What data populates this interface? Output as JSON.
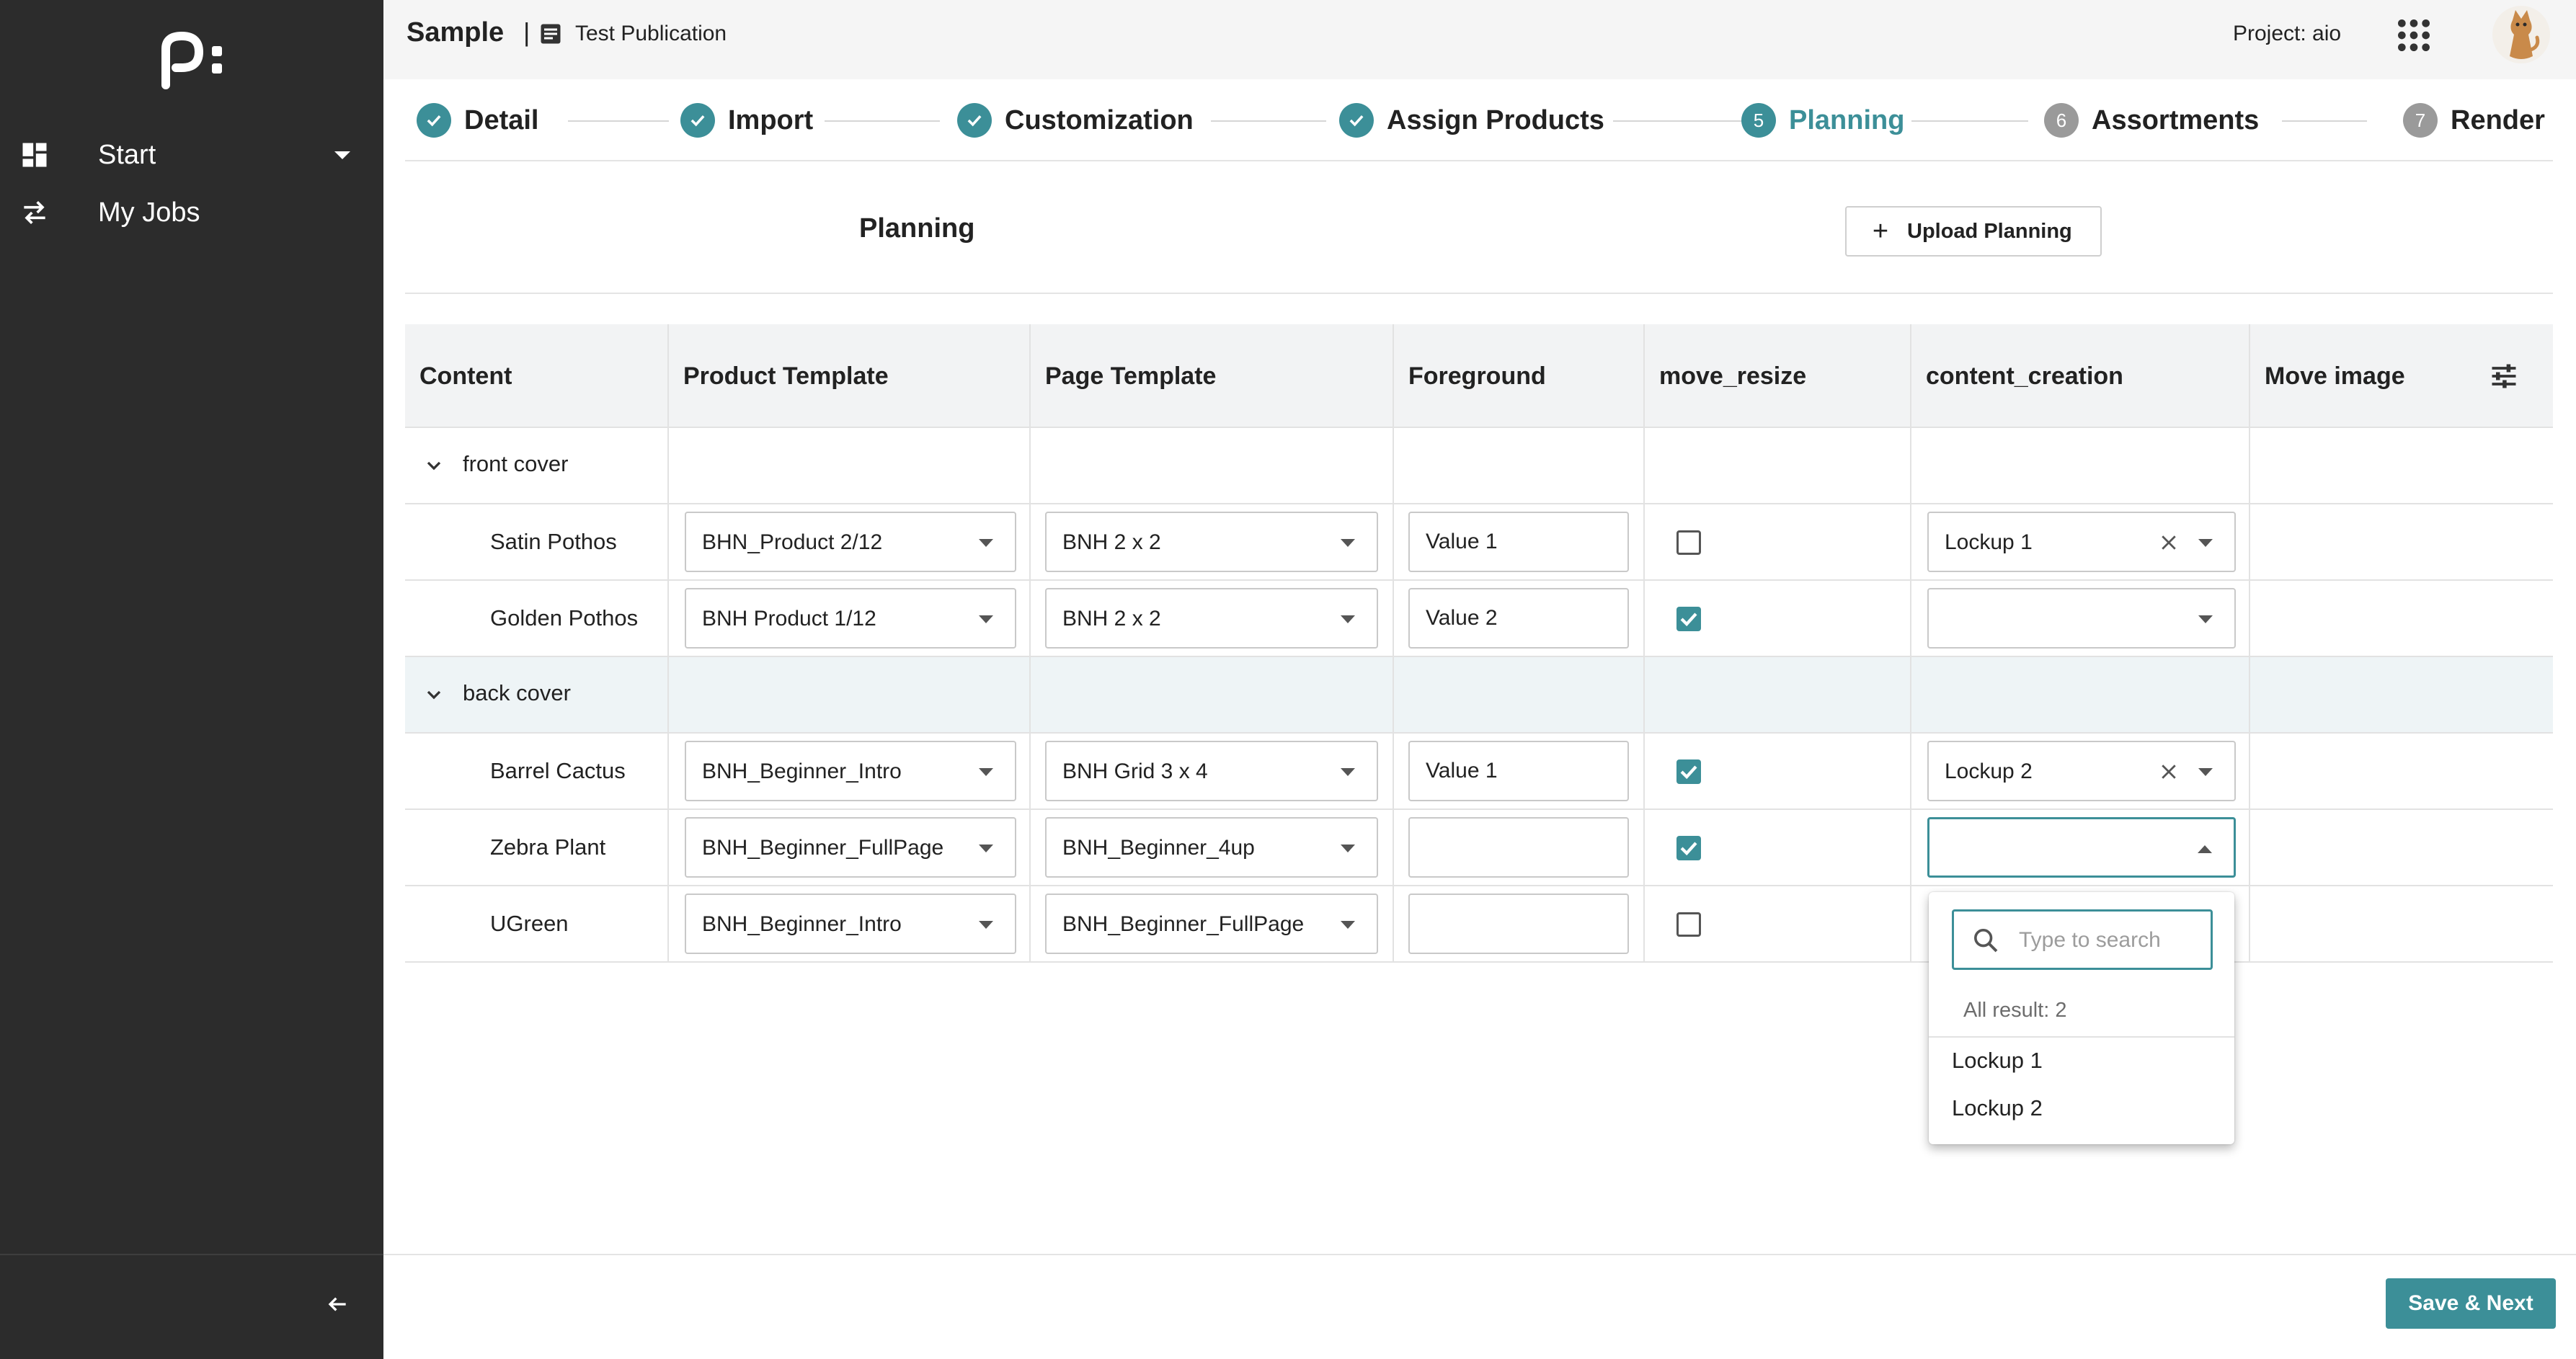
{
  "sidebar": {
    "items": [
      {
        "label": "Start",
        "icon": "dashboard-icon"
      },
      {
        "label": "My Jobs",
        "icon": "swap-icon"
      }
    ]
  },
  "header": {
    "title": "Sample",
    "separator": "|",
    "publication": "Test Publication",
    "project": "Project: aio"
  },
  "steps": [
    {
      "num": "1",
      "label": "Detail",
      "state": "done"
    },
    {
      "num": "2",
      "label": "Import",
      "state": "done"
    },
    {
      "num": "3",
      "label": "Customization",
      "state": "done"
    },
    {
      "num": "4",
      "label": "Assign Products",
      "state": "done"
    },
    {
      "num": "5",
      "label": "Planning",
      "state": "active"
    },
    {
      "num": "6",
      "label": "Assortments",
      "state": "todo"
    },
    {
      "num": "7",
      "label": "Render",
      "state": "todo"
    }
  ],
  "planning": {
    "title": "Planning",
    "upload_label": "Upload Planning"
  },
  "table": {
    "columns": [
      "Content",
      "Product Template",
      "Page Template",
      "Foreground",
      "move_resize",
      "content_creation",
      "Move image"
    ],
    "groups": [
      {
        "label": "front cover",
        "rows": [
          {
            "content": "Satin Pothos",
            "product_template": "BHN_Product 2/12",
            "page_template": "BNH 2 x 2",
            "foreground": "Value 1",
            "move_resize": false,
            "content_creation": "Lockup 1"
          },
          {
            "content": "Golden Pothos",
            "product_template": "BNH Product 1/12",
            "page_template": "BNH 2 x 2",
            "foreground": "Value 2",
            "move_resize": true,
            "content_creation": ""
          }
        ]
      },
      {
        "label": "back cover",
        "rows": [
          {
            "content": "Barrel Cactus",
            "product_template": "BNH_Beginner_Intro",
            "page_template": "BNH Grid 3 x 4",
            "foreground": "Value 1",
            "move_resize": true,
            "content_creation": "Lockup 2"
          },
          {
            "content": "Zebra Plant",
            "product_template": "BNH_Beginner_FullPage",
            "page_template": "BNH_Beginner_4up",
            "foreground": "",
            "move_resize": true,
            "content_creation": ""
          },
          {
            "content": "UGreen",
            "product_template": "BNH_Beginner_Intro",
            "page_template": "BNH_Beginner_FullPage",
            "foreground": "",
            "move_resize": false,
            "content_creation": ""
          }
        ]
      }
    ]
  },
  "dropdown": {
    "placeholder": "Type to search",
    "count_label": "All result: 2",
    "options": [
      "Lockup 1",
      "Lockup 2"
    ]
  },
  "footer": {
    "save_label": "Save & Next"
  },
  "colors": {
    "accent": "#3c8f98",
    "sidebar": "#2c2c2c",
    "pending": "#9a9a9a"
  }
}
